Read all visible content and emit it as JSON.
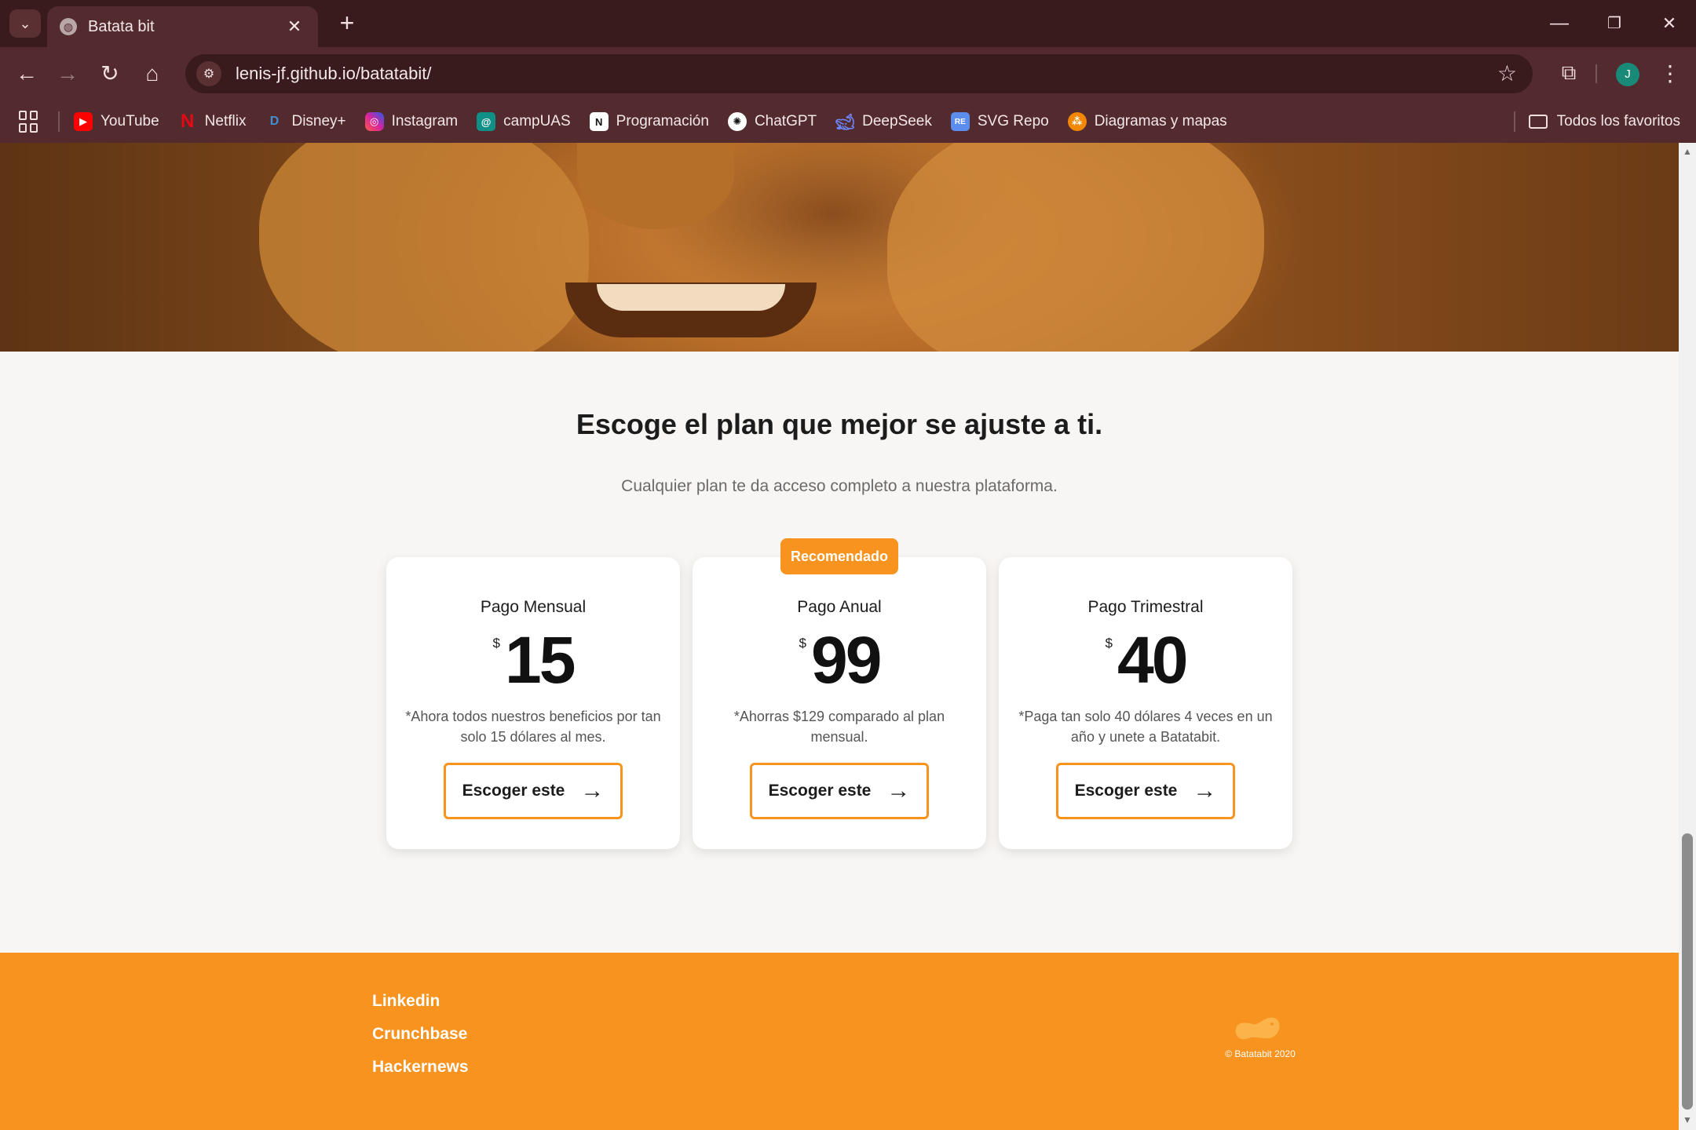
{
  "browser": {
    "tab_title": "Batata bit",
    "tab_close": "✕",
    "new_tab": "+",
    "url": "lenis-jf.github.io/batatabit/",
    "window": {
      "minimize": "—",
      "restore": "❐",
      "close": "✕"
    },
    "profile_initial": "J",
    "bookmarks": [
      {
        "label": "YouTube",
        "icon": "youtube-icon",
        "color": "#ff0000"
      },
      {
        "label": "Netflix",
        "icon": "netflix-icon",
        "color": "#e50914"
      },
      {
        "label": "Disney+",
        "icon": "disney-icon",
        "color": "#1b6aa5"
      },
      {
        "label": "Instagram",
        "icon": "instagram-icon",
        "color": "#d6249f"
      },
      {
        "label": "campUAS",
        "icon": "campuas-icon",
        "color": "#0f8f86"
      },
      {
        "label": "Programación",
        "icon": "notion-icon",
        "color": "#ffffff"
      },
      {
        "label": "ChatGPT",
        "icon": "chatgpt-icon",
        "color": "#ffffff"
      },
      {
        "label": "DeepSeek",
        "icon": "deepseek-icon",
        "color": "#4d6bfe"
      },
      {
        "label": "SVG Repo",
        "icon": "svgrepo-icon",
        "color": "#5b8def"
      },
      {
        "label": "Diagramas y mapas",
        "icon": "diagrams-icon",
        "color": "#f08705"
      }
    ],
    "all_bookmarks": "Todos los favoritos"
  },
  "page": {
    "title": "Escoge el plan que mejor se ajuste a ti.",
    "subtitle": "Cualquier plan te da acceso completo a nuestra plataforma.",
    "badge": "Recomendado",
    "plans": [
      {
        "name": "Pago Mensual",
        "currency": "$",
        "price": "15",
        "desc": "*Ahora todos nuestros beneficios por tan solo 15 dólares al mes.",
        "cta": "Escoger este"
      },
      {
        "name": "Pago Anual",
        "currency": "$",
        "price": "99",
        "desc": "*Ahorras $129 comparado al plan mensual.",
        "cta": "Escoger este"
      },
      {
        "name": "Pago Trimestral",
        "currency": "$",
        "price": "40",
        "desc": "*Paga tan solo 40 dólares 4 veces en un año y unete a Batatabit.",
        "cta": "Escoger este"
      }
    ],
    "footer": {
      "links": [
        "Linkedin",
        "Crunchbase",
        "Hackernews"
      ],
      "copyright": "© Batatabit 2020"
    }
  },
  "colors": {
    "accent": "#f7931e",
    "browser_dark": "#3a1b1d",
    "browser_mid": "#532b2e"
  }
}
